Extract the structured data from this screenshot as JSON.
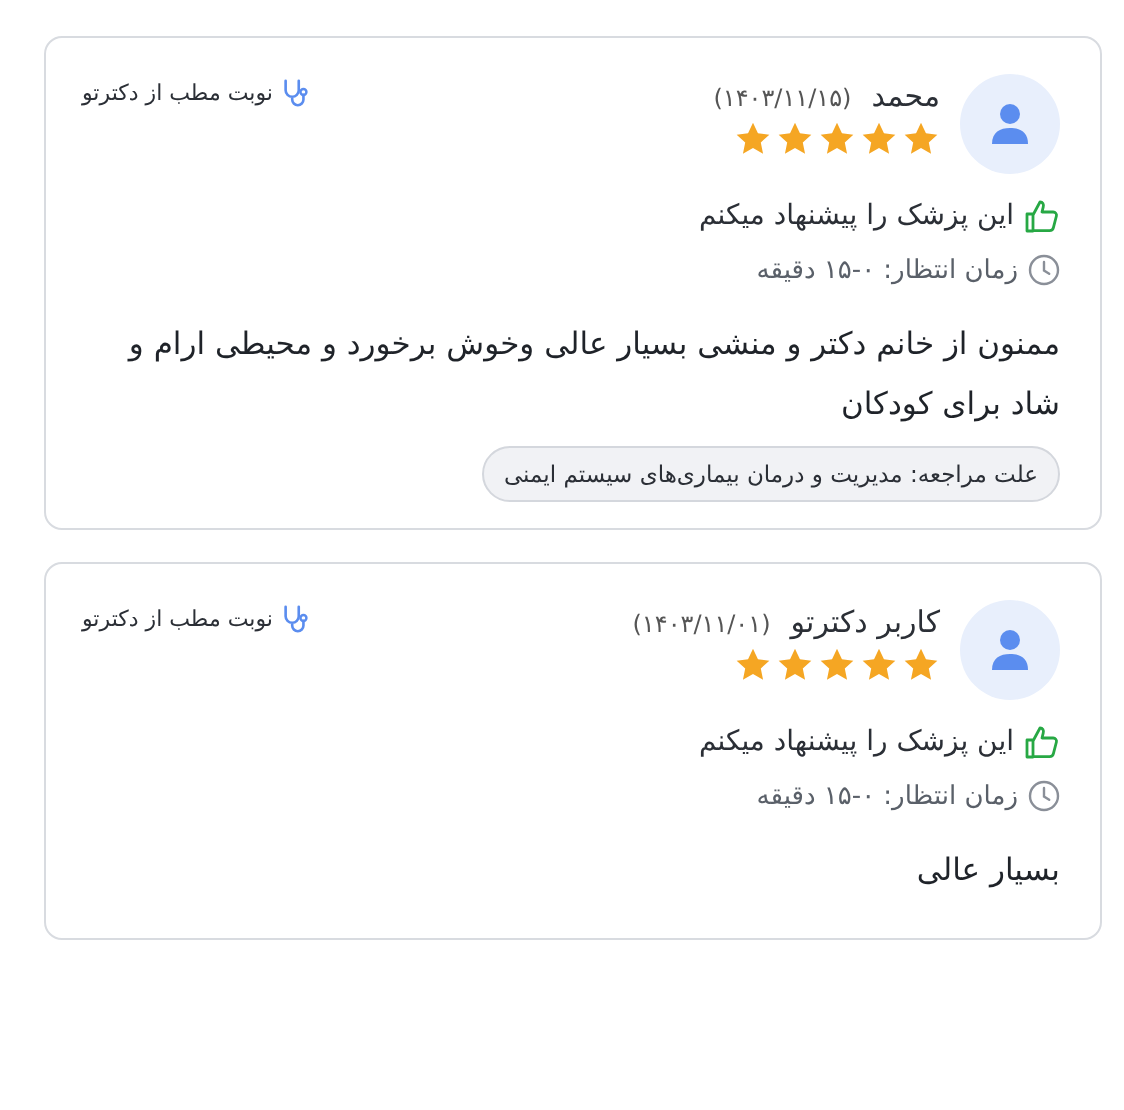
{
  "reviews": [
    {
      "name": "محمد",
      "date": "(۱۴۰۳/۱۱/۱۵)",
      "stars": 5,
      "source": "نوبت مطب از دکترتو",
      "recommendation": "این پزشک را پیشنهاد میکنم",
      "wait_time": "زمان انتظار: ۰-۱۵ دقیقه",
      "comment": "ممنون از خانم دکتر و منشی بسیار عالی وخوش برخورد و محیطی ارام و شاد برای کودکان",
      "reason": "علت مراجعه: مدیریت و درمان بیماری‌های سیستم ایمنی"
    },
    {
      "name": "کاربر دکترتو",
      "date": "(۱۴۰۳/۱۱/۰۱)",
      "stars": 5,
      "source": "نوبت مطب از دکترتو",
      "recommendation": "این پزشک را پیشنهاد میکنم",
      "wait_time": "زمان انتظار: ۰-۱۵ دقیقه",
      "comment": "بسیار عالی"
    }
  ]
}
